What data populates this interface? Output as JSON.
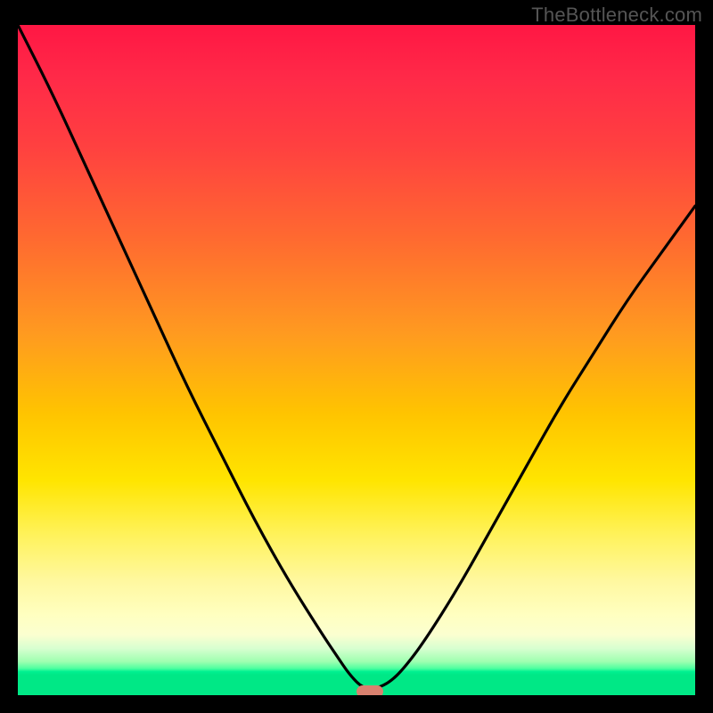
{
  "watermark": "TheBottleneck.com",
  "chart_data": {
    "type": "line",
    "title": "",
    "xlabel": "",
    "ylabel": "",
    "xlim": [
      0,
      100
    ],
    "ylim": [
      0,
      100
    ],
    "grid": false,
    "legend": false,
    "series": [
      {
        "name": "bottleneck-curve",
        "x": [
          0,
          5,
          10,
          15,
          20,
          25,
          30,
          35,
          40,
          45,
          47,
          49,
          51,
          53,
          55,
          57,
          60,
          65,
          70,
          75,
          80,
          85,
          90,
          95,
          100
        ],
        "y": [
          100,
          90,
          79,
          68,
          57,
          46,
          36,
          26,
          17,
          9,
          6,
          3,
          1,
          1,
          2,
          4,
          8,
          16,
          25,
          34,
          43,
          51,
          59,
          66,
          73
        ]
      }
    ],
    "marker": {
      "x": 52,
      "y": 0.5,
      "shape": "rounded-bar",
      "color": "#d9816f"
    },
    "background_gradient": {
      "top": "#ff1744",
      "middle": "#ffe500",
      "bottom": "#00e886"
    }
  }
}
